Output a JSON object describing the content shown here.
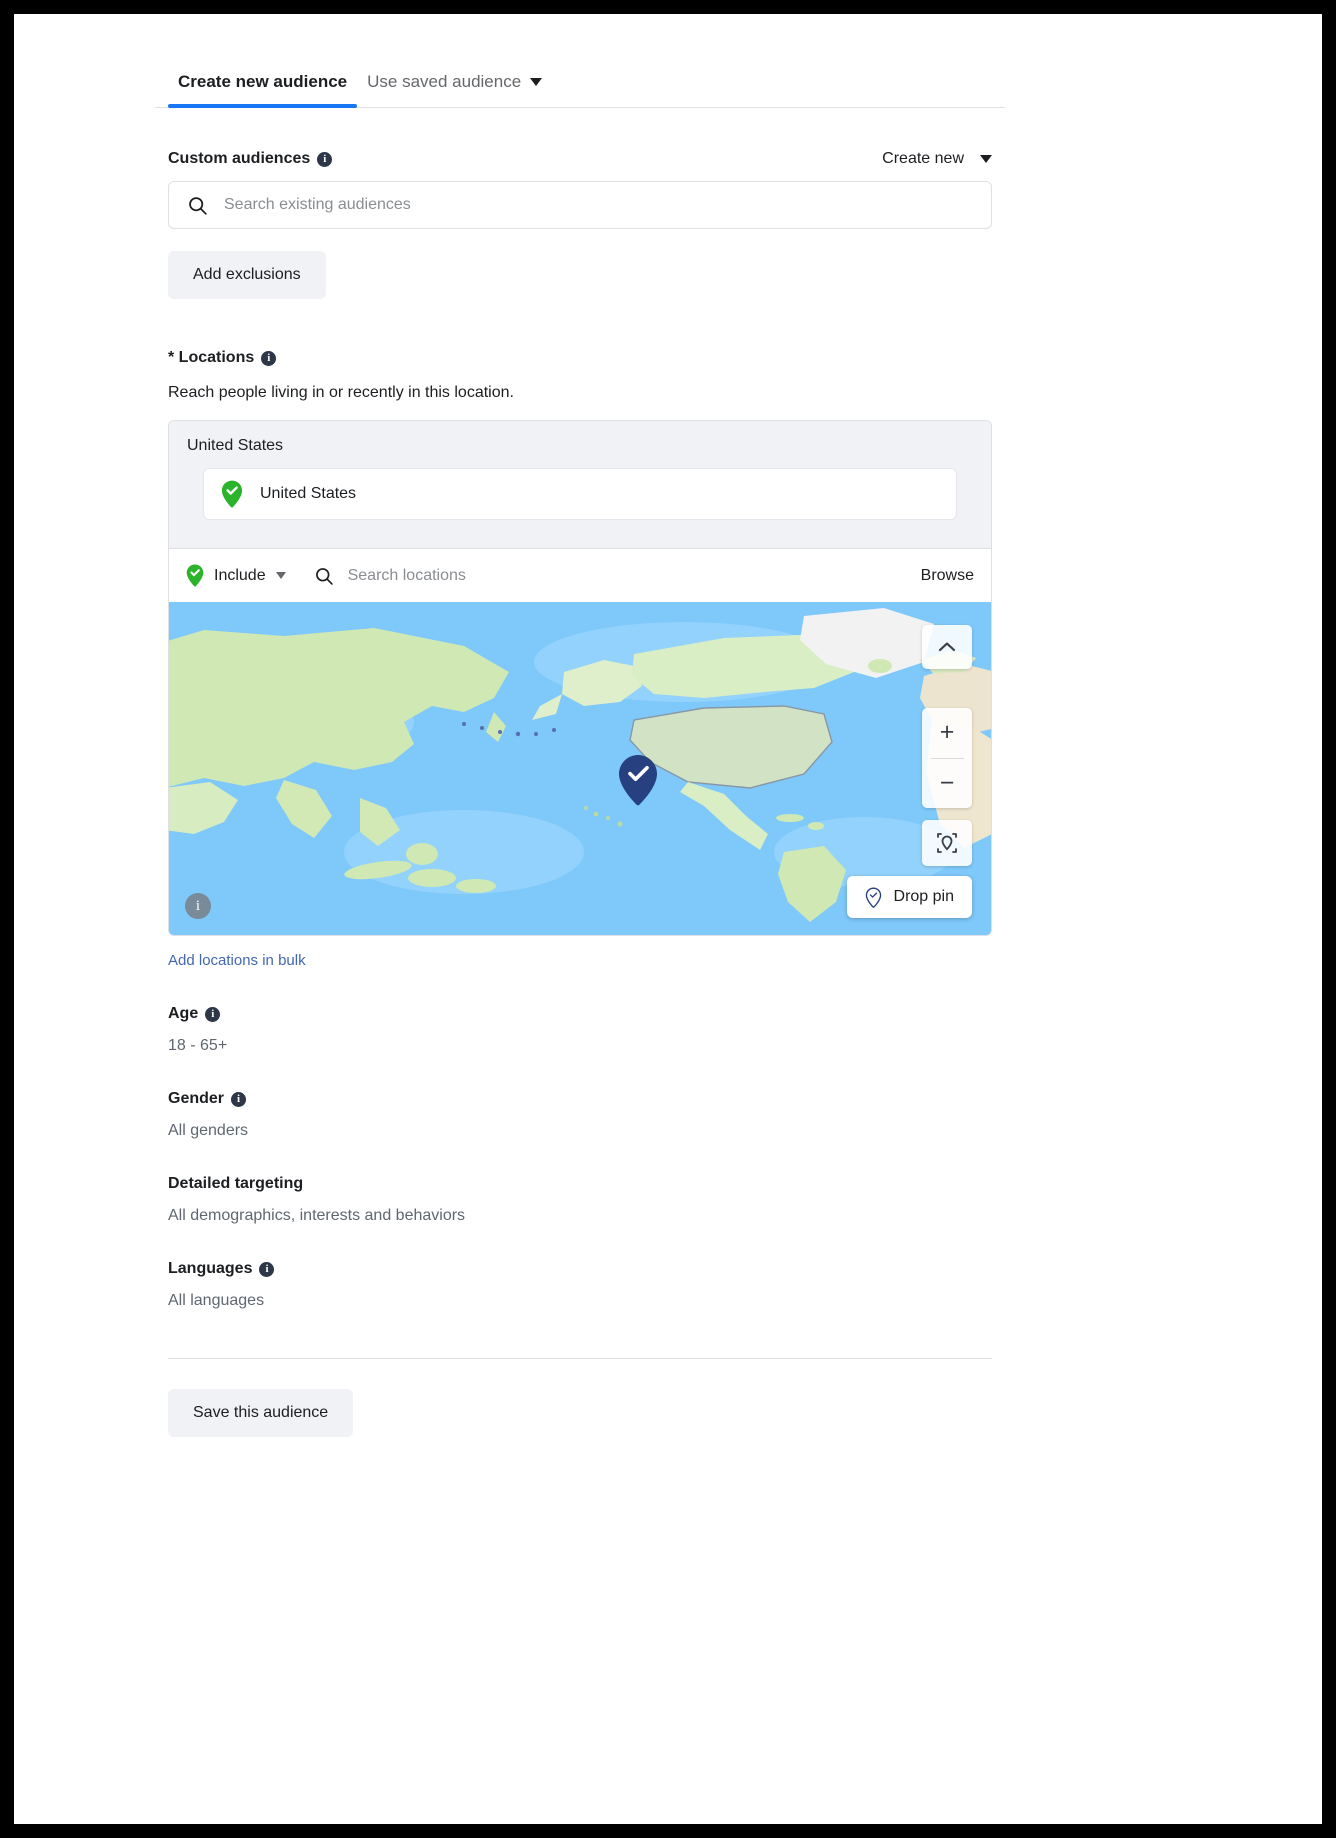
{
  "tabs": [
    {
      "label": "Create new audience",
      "active": true,
      "has_caret": false
    },
    {
      "label": "Use saved audience",
      "active": false,
      "has_caret": true
    }
  ],
  "custom_audiences": {
    "label": "Custom audiences",
    "info_icon": "info-icon",
    "create_new_label": "Create new",
    "search_placeholder": "Search existing audiences",
    "search_icon": "search-icon",
    "add_exclusions_label": "Add exclusions"
  },
  "locations": {
    "label": "* Locations",
    "info_icon": "info-icon",
    "description": "Reach people living in or recently in this location.",
    "group_title": "United States",
    "selected": [
      {
        "name": "United States",
        "icon": "green-pin-check-icon"
      }
    ],
    "toolbar": {
      "mode_label": "Include",
      "mode_icon": "green-pin-check-icon",
      "caret_icon": "chevron-down-icon",
      "search_icon": "search-icon",
      "search_placeholder": "Search locations",
      "browse_label": "Browse"
    },
    "map": {
      "collapse_icon": "chevron-up-icon",
      "zoom_in_label": "+",
      "zoom_out_label": "−",
      "target_icon": "locate-target-icon",
      "drop_pin_label": "Drop pin",
      "drop_pin_icon": "pin-outline-icon",
      "info_icon": "info-circle-icon",
      "marker_icon": "map-pin-check-marker"
    },
    "bulk_link_label": "Add locations in bulk"
  },
  "age": {
    "label": "Age",
    "info_icon": "info-icon",
    "value": "18 - 65+"
  },
  "gender": {
    "label": "Gender",
    "info_icon": "info-icon",
    "value": "All genders"
  },
  "detailed_targeting": {
    "label": "Detailed targeting",
    "value": "All demographics, interests and behaviors"
  },
  "languages": {
    "label": "Languages",
    "info_icon": "info-icon",
    "value": "All languages"
  },
  "footer": {
    "save_label": "Save this audience"
  },
  "colors": {
    "accent_blue": "#1877f2",
    "link_blue": "#4267b2",
    "include_green": "#2bb32b",
    "marker_navy": "#27407f",
    "ocean_blue": "#7ec8fa",
    "land_green": "#c6e6ad",
    "gray_button": "#f0f2f5"
  }
}
